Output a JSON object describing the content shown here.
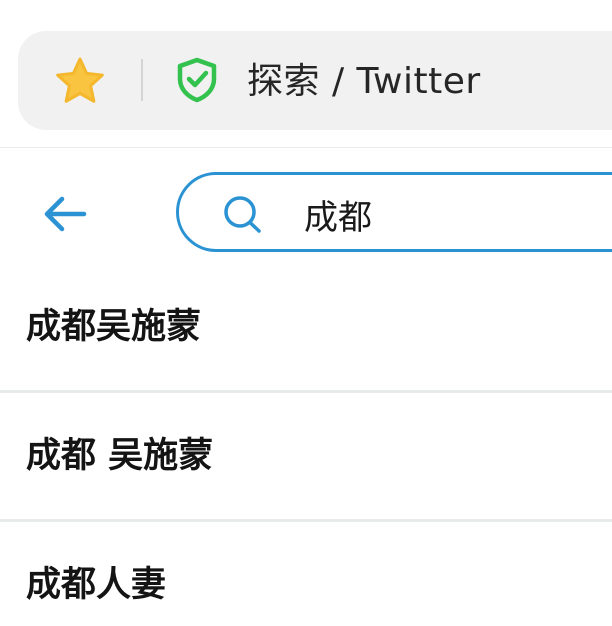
{
  "browser": {
    "title": "探索 / Twitter",
    "bookmark_icon": "star-icon",
    "security_icon": "shield-check-icon",
    "colors": {
      "star": "#f9c440",
      "shield": "#32c24d",
      "address_bar_bg": "#f1f1f1"
    }
  },
  "search": {
    "query": "成都",
    "back_icon": "arrow-left-icon",
    "search_icon": "search-icon",
    "accent": "#2b93d3"
  },
  "suggestions": [
    {
      "label": "成都吴施蒙"
    },
    {
      "label": "成都 吴施蒙"
    },
    {
      "label": "成都人妻"
    }
  ]
}
